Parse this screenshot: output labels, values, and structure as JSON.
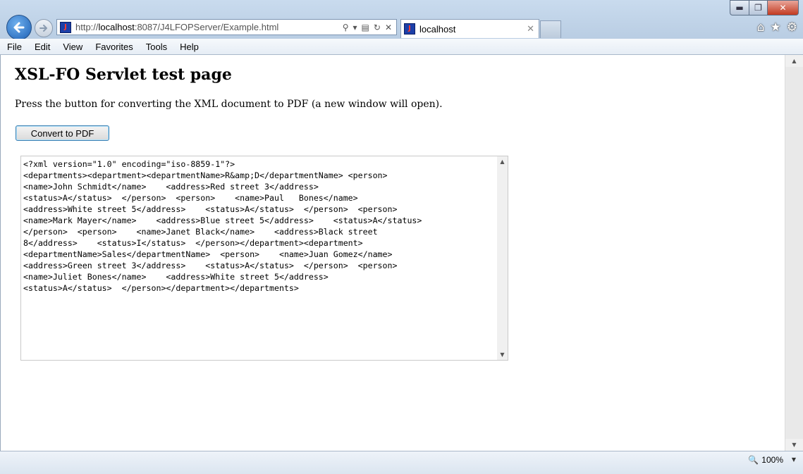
{
  "window": {
    "min_glyph": "▬",
    "max_glyph": "❐",
    "close_glyph": "✕"
  },
  "address_bar": {
    "url_prefix": "http://",
    "url_host": "localhost",
    "url_rest": ":8087/J4LFOPServer/Example.html",
    "search_glyph": "⚲",
    "dropdown_glyph": "▾",
    "compat_glyph": "▤",
    "refresh_glyph": "↻",
    "stop_glyph": "✕"
  },
  "tab": {
    "label": "localhost",
    "close_glyph": "✕"
  },
  "toolbar": {
    "home_glyph": "⌂",
    "favorites_glyph": "★",
    "tools_glyph": "⚙"
  },
  "menu": [
    "File",
    "Edit",
    "View",
    "Favorites",
    "Tools",
    "Help"
  ],
  "page": {
    "title": "XSL-FO Servlet test page",
    "intro": "Press the button for converting the XML document to PDF (a new window will open).",
    "button_label": "Convert to PDF",
    "xml": "<?xml version=\"1.0\" encoding=\"iso-8859-1\"?>\n<departments><department><departmentName>R&amp;D</departmentName> <person>\n<name>John Schmidt</name>    <address>Red street 3</address>\n<status>A</status>  </person>  <person>    <name>Paul   Bones</name>\n<address>White street 5</address>    <status>A</status>  </person>  <person>\n<name>Mark Mayer</name>    <address>Blue street 5</address>    <status>A</status>\n</person>  <person>    <name>Janet Black</name>    <address>Black street\n8</address>    <status>I</status>  </person></department><department>\n<departmentName>Sales</departmentName>  <person>    <name>Juan Gomez</name>\n<address>Green street 3</address>    <status>A</status>  </person>  <person>\n<name>Juliet Bones</name>    <address>White street 5</address>\n<status>A</status>  </person></department></departments>"
  },
  "status": {
    "zoom": "100%",
    "zoom_glyph": "🔍"
  }
}
